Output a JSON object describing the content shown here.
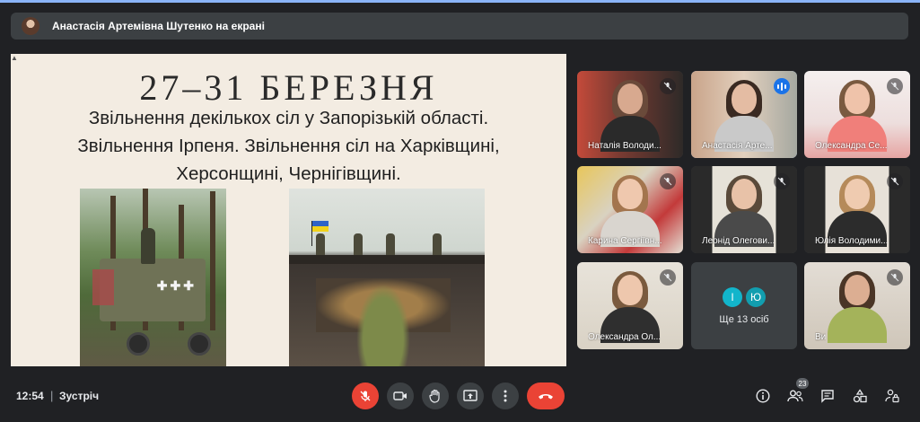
{
  "banner": {
    "presenting_text": "Анастасія Артемівна Шутенко на екрані"
  },
  "slide": {
    "title": "27–31 БЕРЕЗНЯ",
    "lines": [
      "Звільнення декількох сіл у Запорізькій області.",
      "Звільнення Ірпеня. Звільнення сіл на Харківщині,",
      "Херсонщині, Чернігівщині."
    ]
  },
  "participants": [
    {
      "name": "Наталія Володи...",
      "muted": true
    },
    {
      "name": "Анастасія Арте...",
      "speaking": true
    },
    {
      "name": "Олександра Се...",
      "muted": true
    },
    {
      "name": "Карина Сергіївн...",
      "muted": true
    },
    {
      "name": "Леонід Олегови...",
      "muted": true
    },
    {
      "name": "Юлія Володими...",
      "muted": true
    },
    {
      "name": "Олександра Ол...",
      "muted": true
    },
    {
      "name": "Ви",
      "muted": true
    }
  ],
  "more_tile": {
    "avatars": [
      "І",
      "Ю"
    ],
    "label": "Ще 13 осіб"
  },
  "bottom": {
    "time": "12:54",
    "separator": "|",
    "meeting": "Зустріч",
    "people_count": "23"
  },
  "colors": {
    "accent": "#8ab4f8",
    "danger": "#ea4335",
    "surface": "#3c4043",
    "background": "#202124"
  }
}
